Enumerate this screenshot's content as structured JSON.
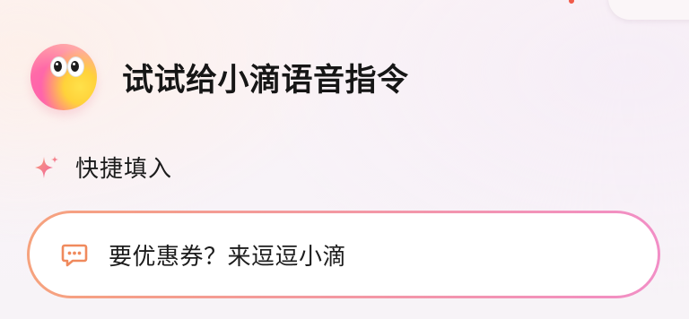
{
  "header": {
    "title": "试试给小滴语音指令"
  },
  "quick_fill": {
    "label": "快捷填入",
    "icon": "sparkle-icon"
  },
  "suggestions": [
    {
      "text": "要优惠券？来逗逗小滴",
      "icon": "chat-bubble-icon"
    }
  ],
  "colors": {
    "pill_border_start": "#f6a27d",
    "pill_border_end": "#f28ec6",
    "chat_icon": "#f08a5d",
    "sparkle": "#f5758f"
  }
}
